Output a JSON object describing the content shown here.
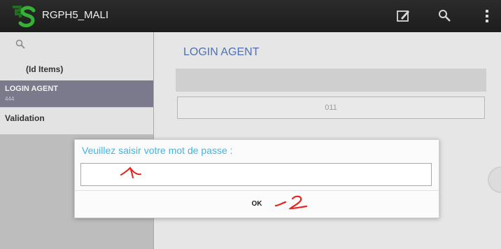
{
  "app": {
    "title": "RGPH5_MALI"
  },
  "toolbar": {
    "icons": [
      "compose-icon",
      "search-icon",
      "overflow-menu-icon"
    ]
  },
  "sidebar": {
    "count_label": "(Id Items)",
    "items": [
      {
        "label": "LOGIN AGENT",
        "sublabel": "444"
      },
      {
        "label": "Validation"
      }
    ]
  },
  "main": {
    "title": "LOGIN AGENT",
    "field_value": "011"
  },
  "dialog": {
    "prompt": "Veuillez saisir votre mot de passe :",
    "password_value": "",
    "ok_label": "OK"
  },
  "annotations": {
    "mark_1": "1",
    "mark_2": "2"
  },
  "colors": {
    "topbar": "#1d1d1d",
    "accent_blue": "#4f70b4",
    "dialog_prompt": "#3fb6de",
    "annotation_red": "#e0281f",
    "selected_item": "#7a7a8c"
  }
}
